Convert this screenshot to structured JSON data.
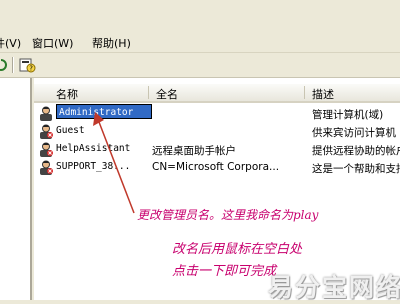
{
  "menubar": {
    "items": [
      {
        "label": "件(V)"
      },
      {
        "label": "窗口(W)"
      },
      {
        "label": "帮助(H)"
      }
    ]
  },
  "list": {
    "columns": [
      "名称",
      "全名",
      "描述"
    ],
    "rows": [
      {
        "name": "Administrator",
        "full_name": "",
        "description": "管理计算机(域)",
        "editing": true
      },
      {
        "name": "Guest",
        "full_name": "",
        "description": "供来宾访问计算机",
        "editing": false
      },
      {
        "name": "HelpAssistant",
        "full_name": "远程桌面助手帐户",
        "description": "提供远程协助的帐户",
        "editing": false
      },
      {
        "name": "SUPPORT_38...",
        "full_name": "CN=Microsoft Corpora...",
        "description": "这是一个帮助和支持",
        "editing": false
      }
    ]
  },
  "annotations": {
    "line1": "更改管理员名。这里我命名为play",
    "line2": "改名后用鼠标在空白处",
    "line3": "点击一下即可完成",
    "color": "#c8006e"
  },
  "watermark": "易分宝网络",
  "colors": {
    "selection": "#316ac5",
    "arrow": "#c0392b",
    "chrome": "#ece9d8"
  }
}
